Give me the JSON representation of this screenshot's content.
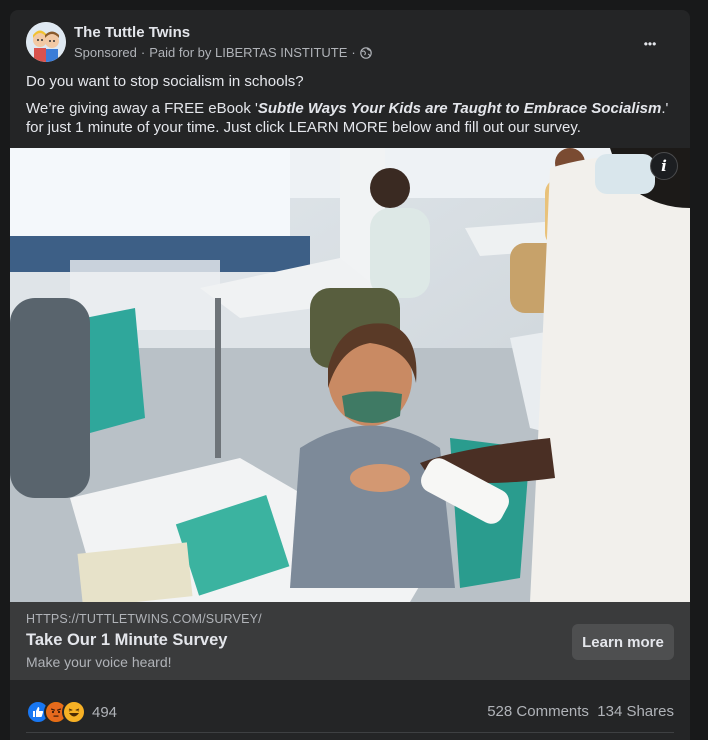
{
  "post": {
    "page_name": "The Tuttle Twins",
    "sponsored": "Sponsored",
    "paid_by": "Paid for by LIBERTAS INSTITUTE",
    "separator": "·",
    "more_label": "•••",
    "line1": "Do you want to stop socialism in schools?",
    "line2_pre": "We’re giving away a FREE eBook '",
    "line2_title": "Subtle Ways Your Kids are Taught to Embrace Socialism",
    "line2_post": ".' for just 1 minute of your time. Just click LEARN MORE below and fill out our survey."
  },
  "image": {
    "info_label": "i"
  },
  "link": {
    "url": "HTTPS://TUTTLETWINS.COM/SURVEY/",
    "title": "Take Our 1 Minute Survey",
    "subtitle": "Make your voice heard!",
    "cta": "Learn more"
  },
  "engagement": {
    "reaction_icons": [
      "like-icon",
      "angry-icon",
      "haha-icon"
    ],
    "reaction_count": "494",
    "comments": "528 Comments",
    "shares": "134 Shares"
  },
  "colors": {
    "background": "#18191a",
    "card": "#242526",
    "link_bar": "#3a3b3c",
    "like": "#1877f2",
    "angry": "#e9710f",
    "haha": "#f7b125"
  }
}
